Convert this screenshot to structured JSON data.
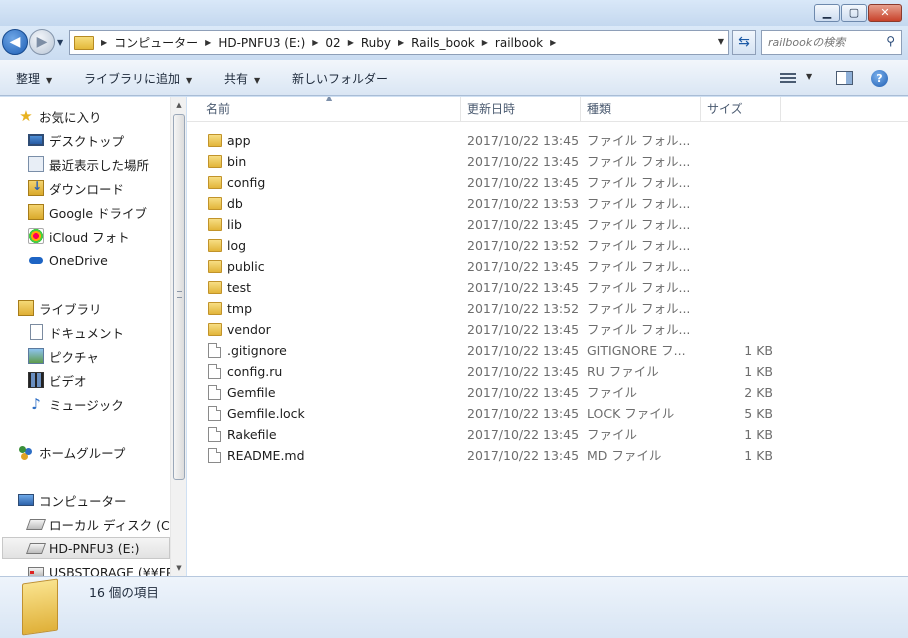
{
  "window": {
    "controls": [
      "minimize",
      "maximize",
      "close"
    ]
  },
  "address": {
    "segments": [
      "コンピューター",
      "HD-PNFU3 (E:)",
      "02",
      "Ruby",
      "Rails_book",
      "railbook"
    ]
  },
  "search": {
    "placeholder": "railbookの検索"
  },
  "toolbar": {
    "organize": "整理",
    "add_to_library": "ライブラリに追加",
    "share": "共有",
    "new_folder": "新しいフォルダー"
  },
  "navpane": {
    "favorites": "お気に入り",
    "desktop": "デスクトップ",
    "recent": "最近表示した場所",
    "downloads": "ダウンロード",
    "google_drive": "Google ドライブ",
    "icloud": "iCloud フォト",
    "onedrive": "OneDrive",
    "libraries": "ライブラリ",
    "documents": "ドキュメント",
    "pictures": "ピクチャ",
    "videos": "ビデオ",
    "music": "ミュージック",
    "homegroup": "ホームグループ",
    "computer": "コンピューター",
    "local_disk": "ローカル ディスク (C:",
    "hd_pnfu3": "HD-PNFU3 (E:)",
    "usbstorage": "USBSTORAGE (¥¥FP"
  },
  "columns": {
    "name": "名前",
    "date": "更新日時",
    "type": "種類",
    "size": "サイズ"
  },
  "files": [
    {
      "name": "app",
      "date": "2017/10/22 13:45",
      "type": "ファイル フォル...",
      "size": "",
      "kind": "folder"
    },
    {
      "name": "bin",
      "date": "2017/10/22 13:45",
      "type": "ファイル フォル...",
      "size": "",
      "kind": "folder"
    },
    {
      "name": "config",
      "date": "2017/10/22 13:45",
      "type": "ファイル フォル...",
      "size": "",
      "kind": "folder"
    },
    {
      "name": "db",
      "date": "2017/10/22 13:53",
      "type": "ファイル フォル...",
      "size": "",
      "kind": "folder"
    },
    {
      "name": "lib",
      "date": "2017/10/22 13:45",
      "type": "ファイル フォル...",
      "size": "",
      "kind": "folder"
    },
    {
      "name": "log",
      "date": "2017/10/22 13:52",
      "type": "ファイル フォル...",
      "size": "",
      "kind": "folder"
    },
    {
      "name": "public",
      "date": "2017/10/22 13:45",
      "type": "ファイル フォル...",
      "size": "",
      "kind": "folder"
    },
    {
      "name": "test",
      "date": "2017/10/22 13:45",
      "type": "ファイル フォル...",
      "size": "",
      "kind": "folder"
    },
    {
      "name": "tmp",
      "date": "2017/10/22 13:52",
      "type": "ファイル フォル...",
      "size": "",
      "kind": "folder"
    },
    {
      "name": "vendor",
      "date": "2017/10/22 13:45",
      "type": "ファイル フォル...",
      "size": "",
      "kind": "folder"
    },
    {
      "name": ".gitignore",
      "date": "2017/10/22 13:45",
      "type": "GITIGNORE フ...",
      "size": "1 KB",
      "kind": "file"
    },
    {
      "name": "config.ru",
      "date": "2017/10/22 13:45",
      "type": "RU ファイル",
      "size": "1 KB",
      "kind": "file"
    },
    {
      "name": "Gemfile",
      "date": "2017/10/22 13:45",
      "type": "ファイル",
      "size": "2 KB",
      "kind": "file"
    },
    {
      "name": "Gemfile.lock",
      "date": "2017/10/22 13:45",
      "type": "LOCK ファイル",
      "size": "5 KB",
      "kind": "file"
    },
    {
      "name": "Rakefile",
      "date": "2017/10/22 13:45",
      "type": "ファイル",
      "size": "1 KB",
      "kind": "file"
    },
    {
      "name": "README.md",
      "date": "2017/10/22 13:45",
      "type": "MD ファイル",
      "size": "1 KB",
      "kind": "file"
    }
  ],
  "details": {
    "item_count": "16 個の項目"
  }
}
